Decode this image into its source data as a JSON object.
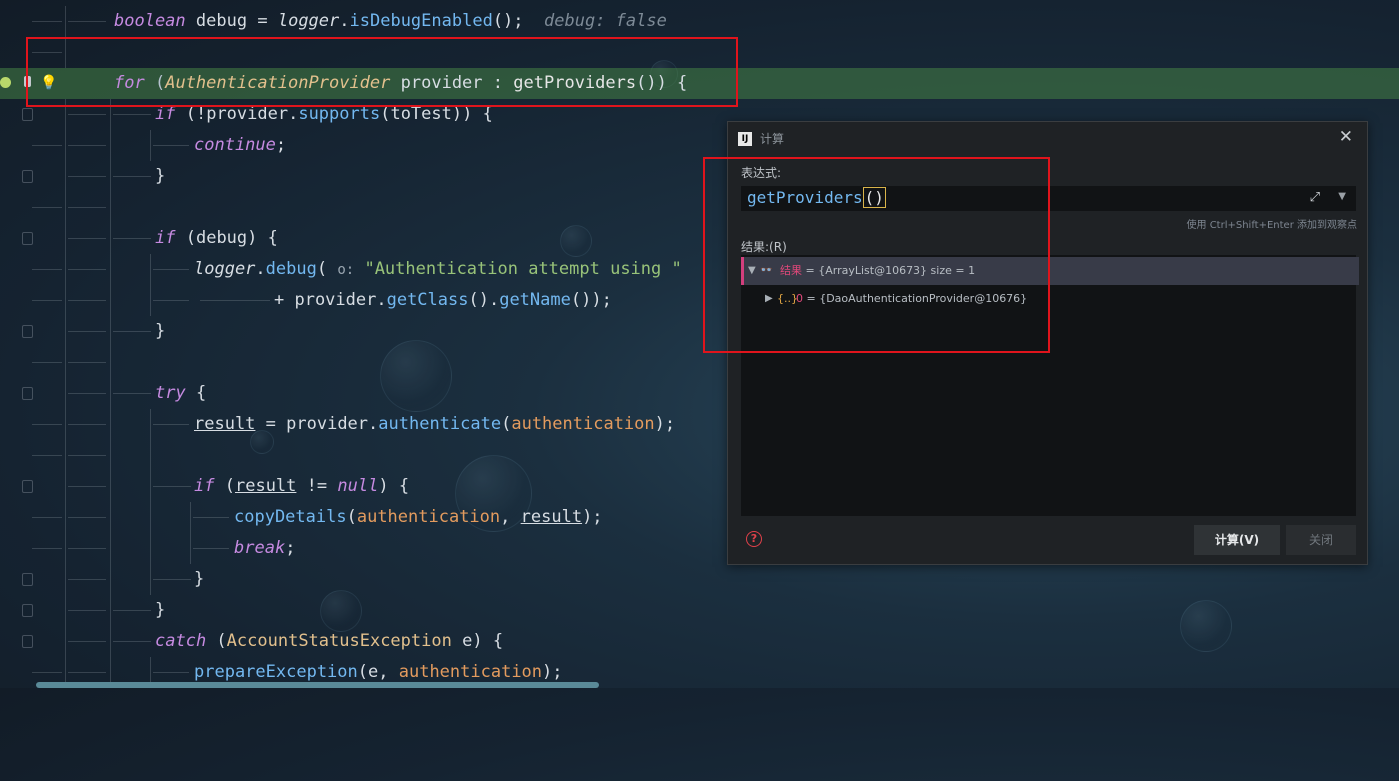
{
  "code": {
    "line1": {
      "kw": "boolean",
      "var": "debug",
      "eq": "=",
      "obj": "logger",
      "method": "isDebugEnabled",
      "tail": "();",
      "hint": "debug: false"
    },
    "line3": {
      "kw": "for",
      "type": "AuthenticationProvider",
      "var": "provider",
      "colon": ":",
      "call": "getProviders",
      "tail": "()) {"
    },
    "line4": {
      "kw": "if",
      "pre": "(!provider.",
      "method": "supports",
      "tail": "(toTest)) {"
    },
    "line5": {
      "kw": "continue",
      "tail": ";"
    },
    "line6": {
      "text": "}"
    },
    "line8": {
      "kw": "if",
      "tail": "(debug) {"
    },
    "line9": {
      "obj": "logger",
      "method": "debug",
      "hint": "o:",
      "str": "\"Authentication attempt using \""
    },
    "line10": {
      "pre": "+ provider.",
      "m1": "getClass",
      "mid": "().",
      "m2": "getName",
      "tail": "());"
    },
    "line11": {
      "text": "}"
    },
    "line13": {
      "kw": "try",
      "tail": "{"
    },
    "line14": {
      "var": "result",
      "mid": "= provider.",
      "method": "authenticate",
      "param": "authentication",
      "tail": ");"
    },
    "line16": {
      "kw": "if",
      "pre": "(",
      "var": "result",
      "mid": "!=",
      "kw2": "null",
      "tail": ") {"
    },
    "line17": {
      "method": "copyDetails",
      "param": "authentication",
      "comma": ",",
      "var": "result",
      "tail": ");"
    },
    "line18": {
      "kw": "break",
      "tail": ";"
    },
    "line19": {
      "text": "}"
    },
    "line20": {
      "text": "}"
    },
    "line21": {
      "kw": "catch",
      "type": "AccountStatusException",
      "var": "e",
      "tail": ") {"
    },
    "line22": {
      "method": "prepareException",
      "pre": "(e,",
      "param": "authentication",
      "tail": ");"
    }
  },
  "dialog": {
    "title": "计算",
    "close_icon": "close-icon",
    "expr_label": "表达式:",
    "expression_call": "getProviders",
    "expression_paren": "()",
    "shortcut_hint": "使用 Ctrl+Shift+Enter 添加到观察点",
    "result_label": "结果:(R)",
    "result_row": {
      "name": "结果",
      "value": "= {ArrayList@10673}  size = 1"
    },
    "child_row": {
      "icon": "{..}",
      "name": "0",
      "value": "= {DaoAuthenticationProvider@10676}"
    },
    "evaluate_button": "计算(V)",
    "close_button": "关闭"
  },
  "colors": {
    "highlight_line": "#3c6b3c",
    "annotation_red": "#e0141c",
    "keyword": "#c58ae0",
    "method": "#73b8f0",
    "string": "#98c379"
  }
}
